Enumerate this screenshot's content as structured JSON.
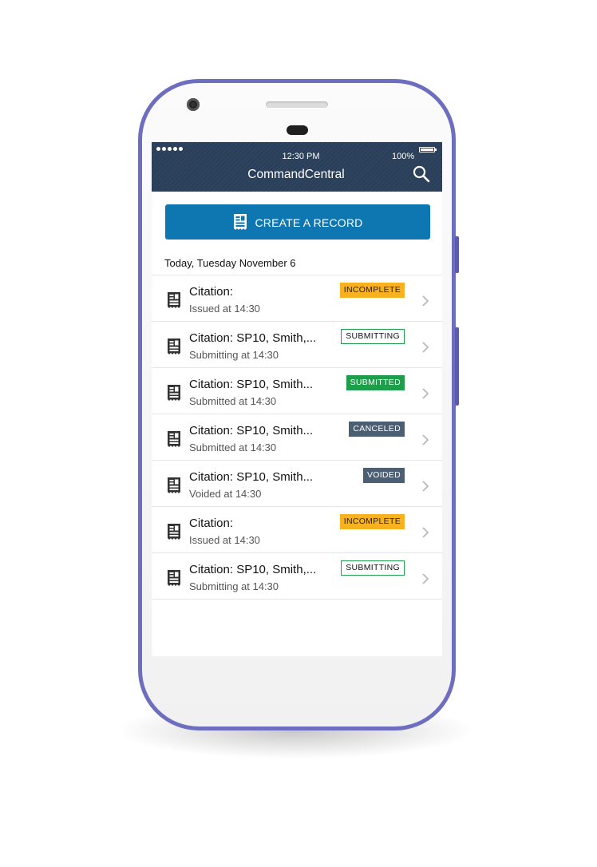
{
  "status_bar": {
    "time": "12:30 PM",
    "battery": "100%"
  },
  "header": {
    "title": "CommandCentral"
  },
  "create_button": {
    "label": "CREATE A RECORD"
  },
  "date_label": "Today, Tuesday November 6",
  "records": [
    {
      "title": "Citation:",
      "subtitle": "Issued at 14:30",
      "status": "INCOMPLETE",
      "status_key": "incomplete"
    },
    {
      "title": "Citation: SP10, Smith,...",
      "subtitle": "Submitting at 14:30",
      "status": "SUBMITTING",
      "status_key": "submitting"
    },
    {
      "title": "Citation: SP10, Smith...",
      "subtitle": "Submitted at 14:30",
      "status": "SUBMITTED",
      "status_key": "submitted"
    },
    {
      "title": "Citation: SP10, Smith...",
      "subtitle": "Submitted at 14:30",
      "status": "CANCELED",
      "status_key": "canceled"
    },
    {
      "title": "Citation: SP10, Smith...",
      "subtitle": "Voided at 14:30",
      "status": "VOIDED",
      "status_key": "voided"
    },
    {
      "title": "Citation:",
      "subtitle": "Issued at 14:30",
      "status": "INCOMPLETE",
      "status_key": "incomplete"
    },
    {
      "title": "Citation: SP10, Smith,...",
      "subtitle": "Submitting at 14:30",
      "status": "SUBMITTING",
      "status_key": "submitting"
    }
  ],
  "icons": {
    "search": "search-icon",
    "record": "citation-document-icon",
    "chevron": "chevron-right-icon"
  },
  "colors": {
    "header_bg": "#2f4460",
    "primary_button": "#0e77b1",
    "incomplete": "#f9b21f",
    "submitted": "#1d9e4a",
    "canceled": "#4c5e72",
    "phone_frame": "#6e6ec0"
  }
}
